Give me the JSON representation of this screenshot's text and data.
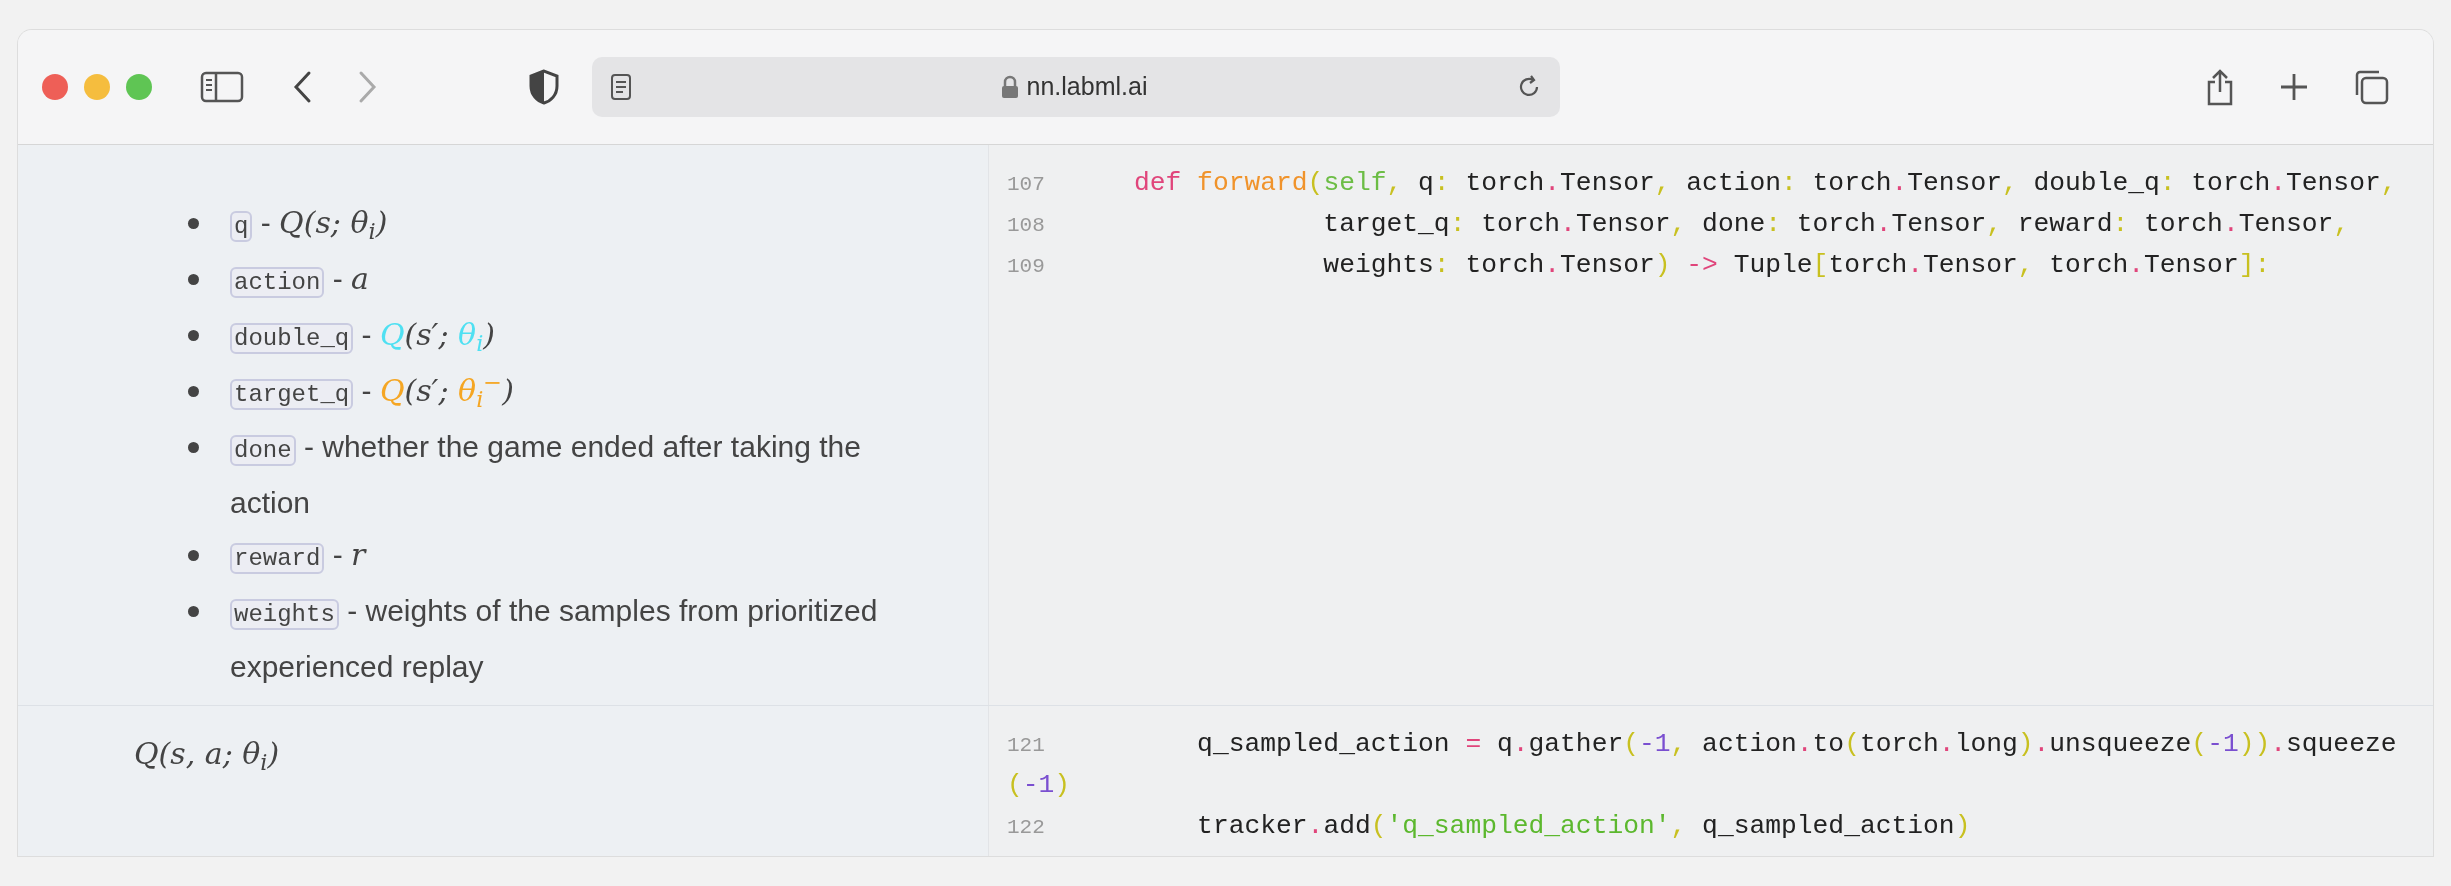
{
  "browser": {
    "url": "nn.labml.ai",
    "back_disabled": false,
    "forward_disabled": true
  },
  "sections": [
    {
      "doc": {
        "kind": "list",
        "items": [
          {
            "code": "q",
            "dash": "-",
            "math": [
              {
                "text": "Q(s; θ$_{i}$)"
              }
            ]
          },
          {
            "code": "action",
            "dash": "-",
            "math": [
              {
                "text": "a"
              }
            ]
          },
          {
            "code": "double_q",
            "dash": "-",
            "math": [
              {
                "text": "Q",
                "color": "#4fe0f2"
              },
              {
                "text": "(s′; "
              },
              {
                "text": "θ$_{i}$",
                "color": "#4fe0f2"
              },
              {
                "text": ")"
              }
            ]
          },
          {
            "code": "target_q",
            "dash": "-",
            "math": [
              {
                "text": "Q",
                "color": "#f5a623"
              },
              {
                "text": "(s′; "
              },
              {
                "text": "θ$_{i}$$^{−}$",
                "color": "#f5a623"
              },
              {
                "text": ")"
              }
            ]
          },
          {
            "code": "done",
            "dash": "-",
            "text": "whether the game ended after taking the action"
          },
          {
            "code": "reward",
            "dash": "-",
            "math": [
              {
                "text": "r"
              }
            ]
          },
          {
            "code": "weights",
            "dash": "-",
            "text": "weights of the samples from prioritized experienced replay"
          }
        ]
      },
      "code": [
        {
          "number": "107",
          "tokens": [
            {
              "kind": "kw",
              "text": "def"
            },
            {
              "kind": "fn",
              "text": " forward"
            },
            {
              "kind": "br",
              "text": "("
            },
            {
              "kind": "self",
              "text": "self"
            },
            {
              "kind": "br",
              "text": ","
            },
            {
              "kind": "p",
              "text": " q"
            },
            {
              "kind": "br",
              "text": ":"
            },
            {
              "kind": "p",
              "text": " torch"
            },
            {
              "kind": "op",
              "text": "."
            },
            {
              "kind": "p",
              "text": "Tensor"
            },
            {
              "kind": "br",
              "text": ","
            },
            {
              "kind": "p",
              "text": " action"
            },
            {
              "kind": "br",
              "text": ":"
            },
            {
              "kind": "p",
              "text": " torch"
            },
            {
              "kind": "op",
              "text": "."
            },
            {
              "kind": "p",
              "text": "Tensor"
            },
            {
              "kind": "br",
              "text": ","
            },
            {
              "kind": "p",
              "text": " double_q"
            },
            {
              "kind": "br",
              "text": ":"
            },
            {
              "kind": "p",
              "text": " torch"
            },
            {
              "kind": "op",
              "text": "."
            },
            {
              "kind": "p",
              "text": "Tensor"
            },
            {
              "kind": "br",
              "text": ","
            }
          ]
        },
        {
          "number": "108",
          "tokens": [
            {
              "kind": "p",
              "text": "            target_q"
            },
            {
              "kind": "br",
              "text": ":"
            },
            {
              "kind": "p",
              "text": " torch"
            },
            {
              "kind": "op",
              "text": "."
            },
            {
              "kind": "p",
              "text": "Tensor"
            },
            {
              "kind": "br",
              "text": ","
            },
            {
              "kind": "p",
              "text": " done"
            },
            {
              "kind": "br",
              "text": ":"
            },
            {
              "kind": "p",
              "text": " torch"
            },
            {
              "kind": "op",
              "text": "."
            },
            {
              "kind": "p",
              "text": "Tensor"
            },
            {
              "kind": "br",
              "text": ","
            },
            {
              "kind": "p",
              "text": " reward"
            },
            {
              "kind": "br",
              "text": ":"
            },
            {
              "kind": "p",
              "text": " torch"
            },
            {
              "kind": "op",
              "text": "."
            },
            {
              "kind": "p",
              "text": "Tensor"
            },
            {
              "kind": "br",
              "text": ","
            }
          ]
        },
        {
          "number": "109",
          "tokens": [
            {
              "kind": "p",
              "text": "            weights"
            },
            {
              "kind": "br",
              "text": ":"
            },
            {
              "kind": "p",
              "text": " torch"
            },
            {
              "kind": "op",
              "text": "."
            },
            {
              "kind": "p",
              "text": "Tensor"
            },
            {
              "kind": "br",
              "text": ")"
            },
            {
              "kind": "op",
              "text": " ->"
            },
            {
              "kind": "p",
              "text": " Tuple"
            },
            {
              "kind": "br",
              "text": "["
            },
            {
              "kind": "p",
              "text": "torch"
            },
            {
              "kind": "op",
              "text": "."
            },
            {
              "kind": "p",
              "text": "Tensor"
            },
            {
              "kind": "br",
              "text": ","
            },
            {
              "kind": "p",
              "text": " torch"
            },
            {
              "kind": "op",
              "text": "."
            },
            {
              "kind": "p",
              "text": "Tensor"
            },
            {
              "kind": "br",
              "text": "]:"
            }
          ]
        }
      ]
    },
    {
      "doc": {
        "kind": "math",
        "math": [
          {
            "text": "Q(s, a; θ$_{i}$)"
          }
        ]
      },
      "code": [
        {
          "number": "121",
          "tokens": [
            {
              "kind": "p",
              "text": "    q_sampled_action "
            },
            {
              "kind": "op",
              "text": "="
            },
            {
              "kind": "p",
              "text": " q"
            },
            {
              "kind": "op",
              "text": "."
            },
            {
              "kind": "p",
              "text": "gather"
            },
            {
              "kind": "br",
              "text": "("
            },
            {
              "kind": "num",
              "text": "-1"
            },
            {
              "kind": "br",
              "text": ","
            },
            {
              "kind": "p",
              "text": " action"
            },
            {
              "kind": "op",
              "text": "."
            },
            {
              "kind": "p",
              "text": "to"
            },
            {
              "kind": "br",
              "text": "("
            },
            {
              "kind": "p",
              "text": "torch"
            },
            {
              "kind": "op",
              "text": "."
            },
            {
              "kind": "p",
              "text": "long"
            },
            {
              "kind": "br",
              "text": ")"
            },
            {
              "kind": "op",
              "text": "."
            },
            {
              "kind": "p",
              "text": "unsqueeze"
            },
            {
              "kind": "br",
              "text": "("
            },
            {
              "kind": "num",
              "text": "-1"
            },
            {
              "kind": "br",
              "text": "))"
            },
            {
              "kind": "op",
              "text": "."
            },
            {
              "kind": "p",
              "text": "squeeze"
            }
          ],
          "continuation": [
            {
              "kind": "br",
              "text": "("
            },
            {
              "kind": "num",
              "text": "-1"
            },
            {
              "kind": "br",
              "text": ")"
            }
          ]
        },
        {
          "number": "122",
          "tokens": [
            {
              "kind": "p",
              "text": "    tracker"
            },
            {
              "kind": "op",
              "text": "."
            },
            {
              "kind": "p",
              "text": "add"
            },
            {
              "kind": "br",
              "text": "("
            },
            {
              "kind": "str",
              "text": "'q_sampled_action'"
            },
            {
              "kind": "br",
              "text": ","
            },
            {
              "kind": "p",
              "text": " q_sampled_action"
            },
            {
              "kind": "br",
              "text": ")"
            }
          ]
        }
      ]
    }
  ]
}
